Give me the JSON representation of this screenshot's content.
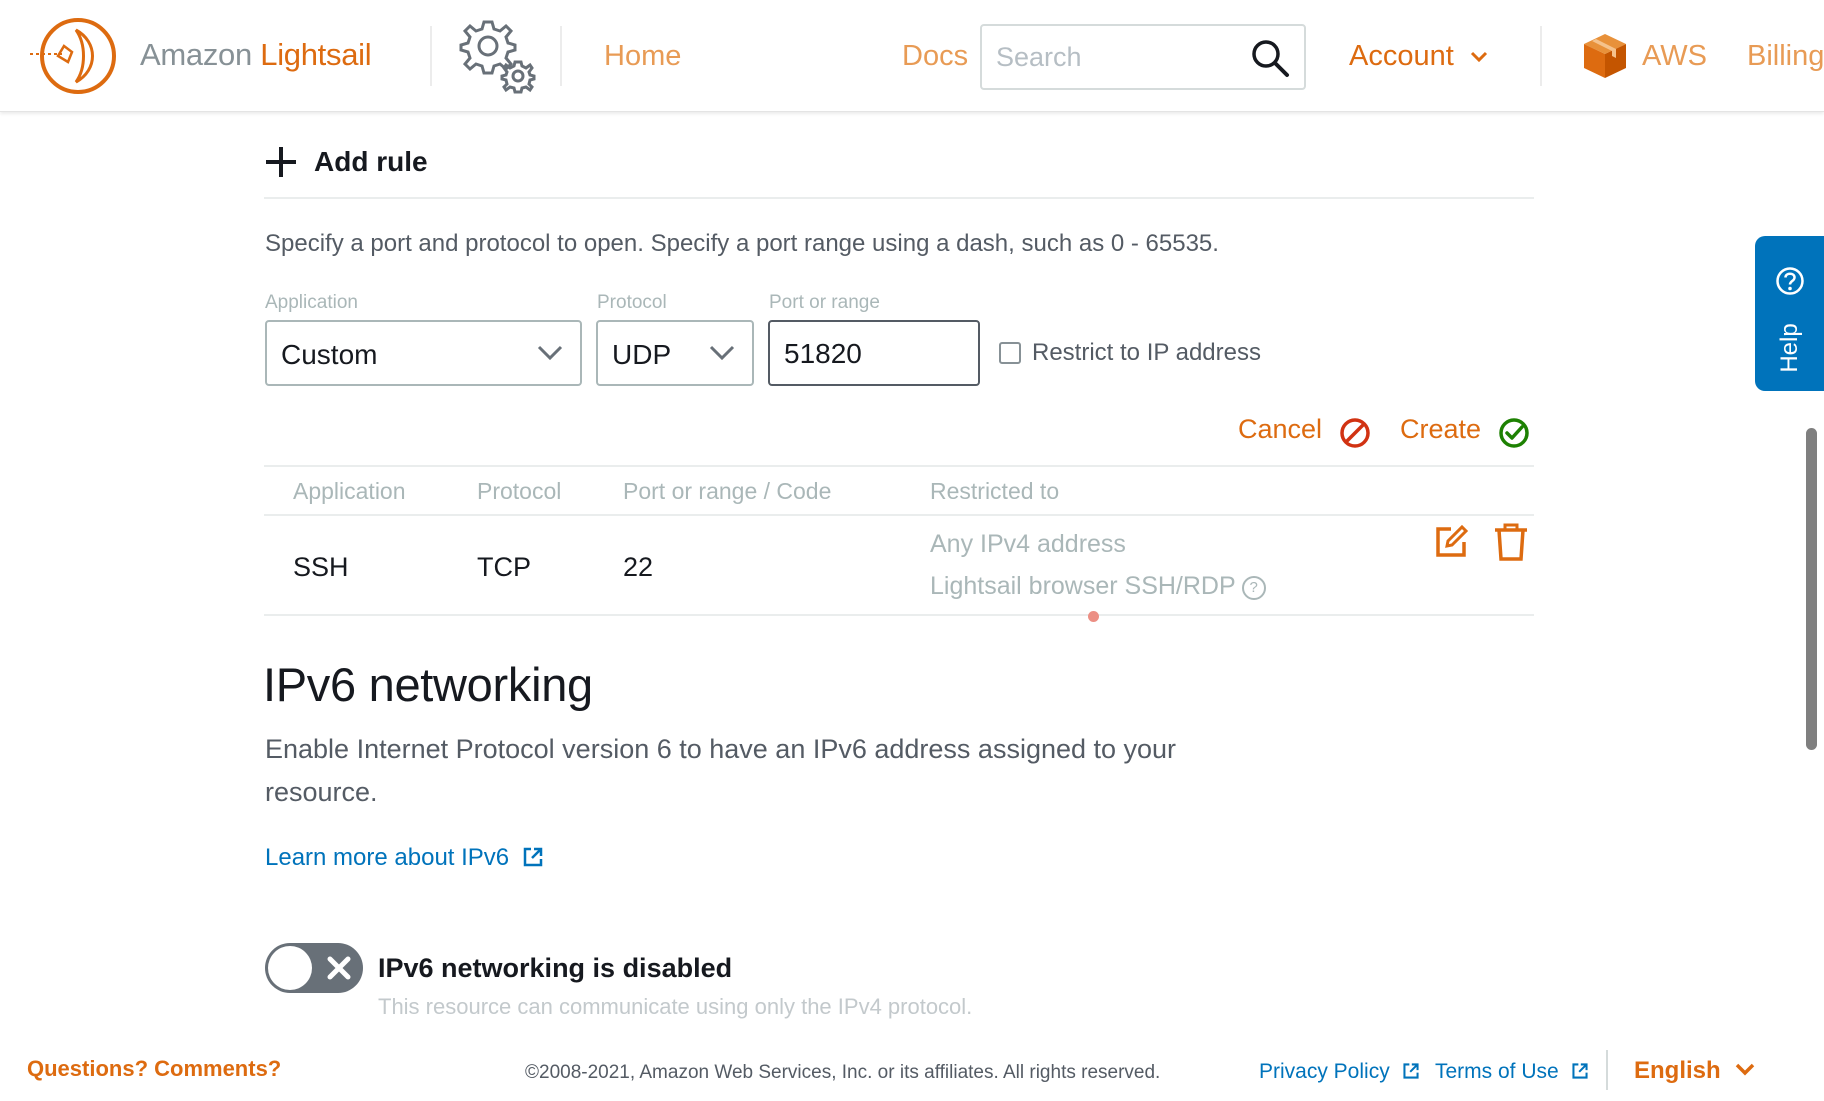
{
  "header": {
    "brand_prefix": "Amazon",
    "brand_name": "Lightsail",
    "nav_home": "Home",
    "nav_docs": "Docs",
    "search_placeholder": "Search",
    "nav_account": "Account",
    "nav_aws": "AWS",
    "nav_billing": "Billing"
  },
  "add_rule": {
    "label": "Add rule",
    "hint": "Specify a port and protocol to open. Specify a port range using a dash, such as 0 - 65535.",
    "application_label": "Application",
    "application_value": "Custom",
    "protocol_label": "Protocol",
    "protocol_value": "UDP",
    "port_label": "Port or range",
    "port_value": "51820",
    "restrict_label": "Restrict to IP address",
    "restrict_checked": false,
    "cancel_label": "Cancel",
    "create_label": "Create"
  },
  "rules_table": {
    "columns": [
      "Application",
      "Protocol",
      "Port or range / Code",
      "Restricted to"
    ],
    "rows": [
      {
        "application": "SSH",
        "protocol": "TCP",
        "port": "22",
        "restricted_line1": "Any IPv4 address",
        "restricted_line2": "Lightsail browser SSH/RDP"
      }
    ]
  },
  "ipv6": {
    "title": "IPv6 networking",
    "description": "Enable Internet Protocol version 6 to have an IPv6 address assigned to your resource.",
    "learn_more": "Learn more about IPv6",
    "toggle_enabled": false,
    "status_title": "IPv6 networking is disabled",
    "status_desc": "This resource can communicate using only the IPv4 protocol."
  },
  "footer": {
    "questions": "Questions? Comments?",
    "copyright": "©2008-2021, Amazon Web Services, Inc. or its affiliates. All rights reserved.",
    "privacy": "Privacy Policy",
    "terms": "Terms of Use",
    "language": "English"
  },
  "help_tab": {
    "label": "Help"
  },
  "colors": {
    "brand_orange": "#dd6b10",
    "link_blue": "#0073bb",
    "create_green": "#1d8102",
    "cancel_red": "#d13212"
  },
  "icons": [
    "lightsail-logo-icon",
    "settings-gear-icon",
    "search-icon",
    "chevron-down-icon",
    "aws-cube-icon",
    "plus-icon",
    "cancel-icon",
    "create-check-icon",
    "edit-icon",
    "trash-icon",
    "help-question-icon",
    "external-link-icon",
    "toggle-x-icon"
  ]
}
